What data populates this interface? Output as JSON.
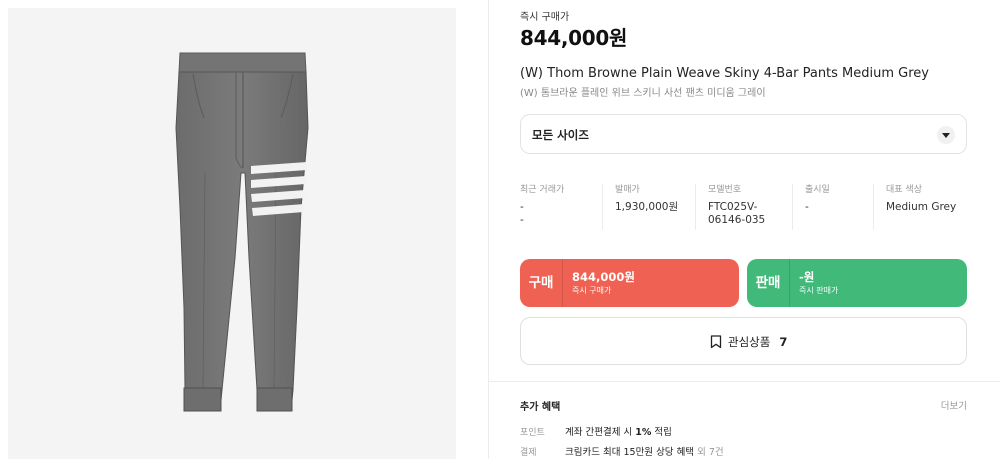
{
  "product": {
    "price_label": "즉시 구매가",
    "price": "844,000원",
    "title_en": "(W) Thom Browne Plain Weave Skiny 4-Bar Pants Medium Grey",
    "title_ko": "(W) 톰브라운 플레인 위브 스키니 사선 팬츠 미디움 그레이",
    "image_icon": "pants-image"
  },
  "size_select": {
    "label": "모든 사이즈",
    "icon": "chevron-down-icon"
  },
  "info": [
    {
      "header": "최근 거래가",
      "value": "-",
      "value2": "-"
    },
    {
      "header": "발매가",
      "value": "1,930,000원",
      "value2": ""
    },
    {
      "header": "모델번호",
      "value": "FTC025V-",
      "value2": "06146-035"
    },
    {
      "header": "출시일",
      "value": "-",
      "value2": ""
    },
    {
      "header": "대표 색상",
      "value": "Medium Grey",
      "value2": ""
    }
  ],
  "buy_button": {
    "kind": "구매",
    "amount": "844,000원",
    "sub": "즉시 구매가",
    "color": "#ef6253"
  },
  "sell_button": {
    "kind": "판매",
    "amount": "-원",
    "sub": "즉시 판매가",
    "color": "#41b979"
  },
  "wish": {
    "label": "관심상품",
    "count": "7",
    "icon": "bookmark-icon"
  },
  "benefits": {
    "title": "추가 혜택",
    "more": "더보기",
    "rows": [
      {
        "key": "포인트",
        "text_a": "계좌 간편결제 시 ",
        "text_bold": "1%",
        "text_b": " 적립",
        "extra": ""
      },
      {
        "key": "결제",
        "text_a": "크림카드 최대 15만원 상당 혜택",
        "text_bold": "",
        "text_b": "",
        "extra": " 외 7건"
      }
    ]
  }
}
